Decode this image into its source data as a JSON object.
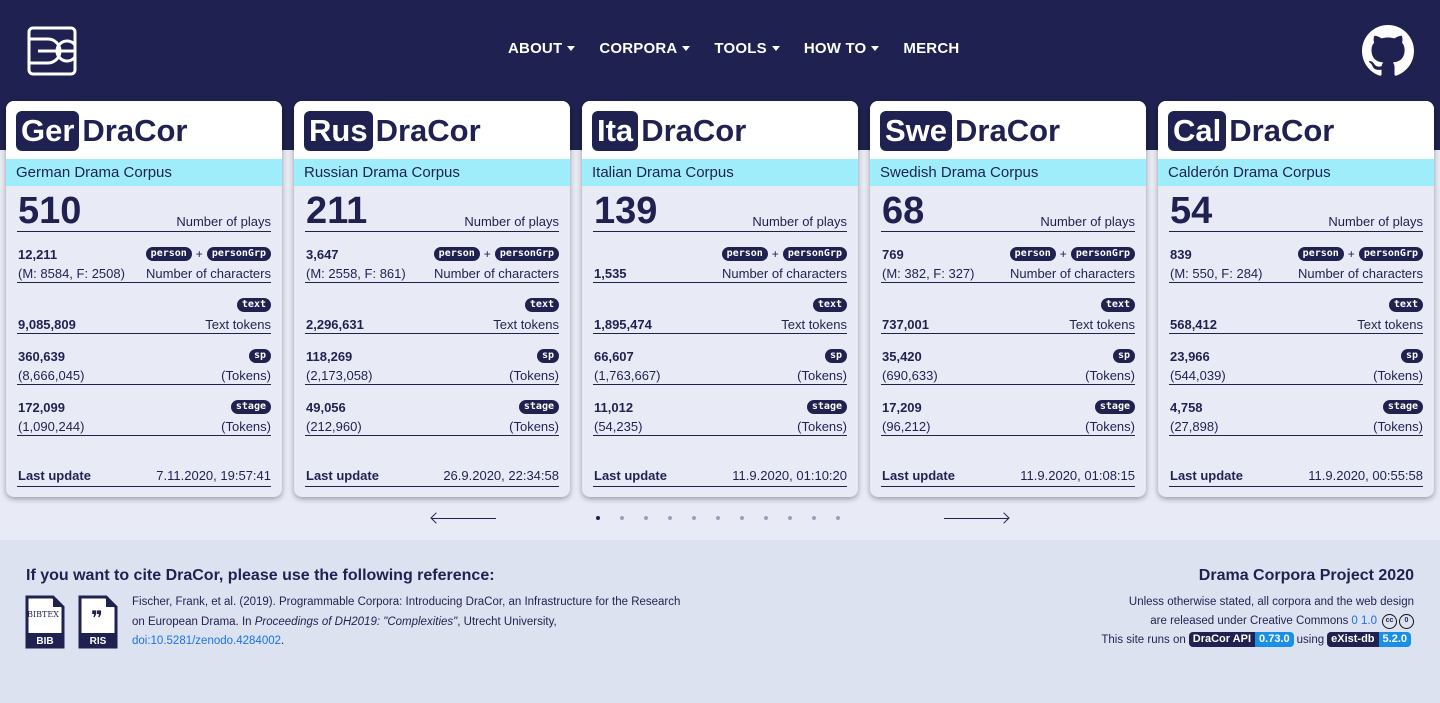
{
  "nav": {
    "items": [
      {
        "label": "ABOUT",
        "dropdown": true
      },
      {
        "label": "CORPORA",
        "dropdown": true
      },
      {
        "label": "TOOLS",
        "dropdown": true
      },
      {
        "label": "HOW TO",
        "dropdown": true
      },
      {
        "label": "MERCH",
        "dropdown": false
      }
    ]
  },
  "cards": [
    {
      "abbr": "Ger",
      "name": "DraCor",
      "subtitle": "German Drama Corpus",
      "plays": "510",
      "plays_label": "Number of plays",
      "characters": "12,211",
      "characters_sub": "(M: 8584, F: 2508)",
      "characters_label": "Number of characters",
      "text_tokens": "9,085,809",
      "text_label": "Text tokens",
      "sp": "360,639",
      "sp_sub": "(8,666,045)",
      "sp_label": "(Tokens)",
      "stage": "172,099",
      "stage_sub": "(1,090,244)",
      "stage_label": "(Tokens)",
      "update_label": "Last update",
      "update": "7.11.2020, 19:57:41"
    },
    {
      "abbr": "Rus",
      "name": "DraCor",
      "subtitle": "Russian Drama Corpus",
      "plays": "211",
      "plays_label": "Number of plays",
      "characters": "3,647",
      "characters_sub": "(M: 2558, F: 861)",
      "characters_label": "Number of characters",
      "text_tokens": "2,296,631",
      "text_label": "Text tokens",
      "sp": "118,269",
      "sp_sub": "(2,173,058)",
      "sp_label": "(Tokens)",
      "stage": "49,056",
      "stage_sub": "(212,960)",
      "stage_label": "(Tokens)",
      "update_label": "Last update",
      "update": "26.9.2020, 22:34:58"
    },
    {
      "abbr": "Ita",
      "name": "DraCor",
      "subtitle": "Italian Drama Corpus",
      "plays": "139",
      "plays_label": "Number of plays",
      "characters": "1,535",
      "characters_sub": "",
      "characters_label": "Number of characters",
      "text_tokens": "1,895,474",
      "text_label": "Text tokens",
      "sp": "66,607",
      "sp_sub": "(1,763,667)",
      "sp_label": "(Tokens)",
      "stage": "11,012",
      "stage_sub": "(54,235)",
      "stage_label": "(Tokens)",
      "update_label": "Last update",
      "update": "11.9.2020, 01:10:20"
    },
    {
      "abbr": "Swe",
      "name": "DraCor",
      "subtitle": "Swedish Drama Corpus",
      "plays": "68",
      "plays_label": "Number of plays",
      "characters": "769",
      "characters_sub": "(M: 382, F: 327)",
      "characters_label": "Number of characters",
      "text_tokens": "737,001",
      "text_label": "Text tokens",
      "sp": "35,420",
      "sp_sub": "(690,633)",
      "sp_label": "(Tokens)",
      "stage": "17,209",
      "stage_sub": "(96,212)",
      "stage_label": "(Tokens)",
      "update_label": "Last update",
      "update": "11.9.2020, 01:08:15"
    },
    {
      "abbr": "Cal",
      "name": "DraCor",
      "subtitle": "Calderón Drama Corpus",
      "plays": "54",
      "plays_label": "Number of plays",
      "characters": "839",
      "characters_sub": "(M: 550, F: 284)",
      "characters_label": "Number of characters",
      "text_tokens": "568,412",
      "text_label": "Text tokens",
      "sp": "23,966",
      "sp_sub": "(544,039)",
      "sp_label": "(Tokens)",
      "stage": "4,758",
      "stage_sub": "(27,898)",
      "stage_label": "(Tokens)",
      "update_label": "Last update",
      "update": "11.9.2020, 00:55:58"
    }
  ],
  "badges": {
    "person": "person",
    "plus": "+",
    "personGrp": "personGrp",
    "text": "text",
    "sp": "sp",
    "stage": "stage"
  },
  "carousel": {
    "dot_count": 11,
    "active_index": 0
  },
  "footer": {
    "cite_heading": "If you want to cite DraCor, please use the following reference:",
    "bib_label": "BIB",
    "bib_glyph": "BIBTEX",
    "ris_label": "RIS",
    "ris_glyph": "❞",
    "cite_line1": "Fischer, Frank, et al. (2019). Programmable Corpora: Introducing DraCor, an Infrastructure for the Research",
    "cite_line2a": "on European Drama. In ",
    "cite_line2b": "Proceedings of DH2019: \"Complexities\"",
    "cite_line2c": ", Utrecht University,",
    "cite_doi": "doi:10.5281/zenodo.4284002",
    "cite_doi_end": ".",
    "project_title": "Drama Corpora Project 2020",
    "license_line1": "Unless otherwise stated, all corpora and the web design",
    "license_line2": "are released under Creative Commons",
    "license_version": "0 1.0",
    "cc_glyph1": "cc",
    "cc_glyph2": "0",
    "runs_on": "This site runs on",
    "api_label": "DraCor API",
    "api_version": "0.73.0",
    "using": "using",
    "exist_label": "eXist-db",
    "exist_version": "5.2.0"
  },
  "colors": {
    "navy": "#1f2150",
    "cyan": "#9fedfb",
    "link": "#1a73e8",
    "bg": "#e8ebf6"
  }
}
